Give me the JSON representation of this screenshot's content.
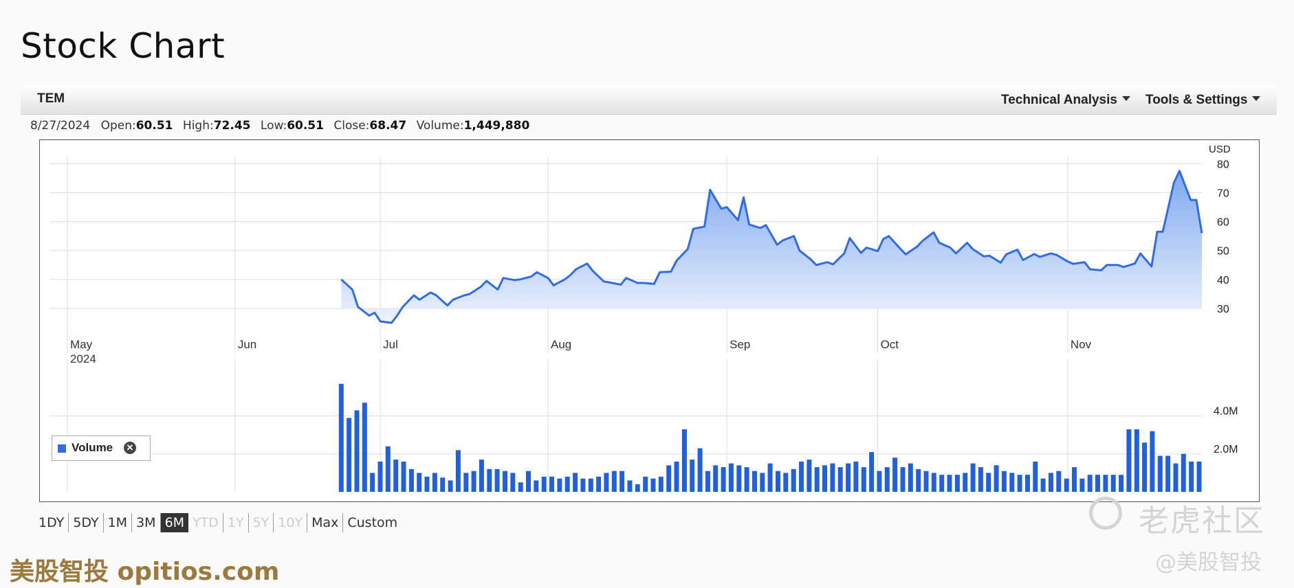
{
  "page": {
    "title": "Stock Chart"
  },
  "toolbar": {
    "ticker": "TEM",
    "technical_analysis": "Technical Analysis",
    "tools_settings": "Tools & Settings"
  },
  "ohlc": {
    "date": "8/27/2024",
    "open_label": "Open:",
    "open": "60.51",
    "high_label": "High:",
    "high": "72.45",
    "low_label": "Low:",
    "low": "60.51",
    "close_label": "Close:",
    "close": "68.47",
    "volume_label": "Volume:",
    "volume": "1,449,880"
  },
  "volume_legend": {
    "label": "Volume"
  },
  "range_buttons": [
    {
      "label": "1DY",
      "state": "normal"
    },
    {
      "label": "5DY",
      "state": "normal"
    },
    {
      "label": "1M",
      "state": "normal"
    },
    {
      "label": "3M",
      "state": "normal"
    },
    {
      "label": "6M",
      "state": "active"
    },
    {
      "label": "YTD",
      "state": "disabled"
    },
    {
      "label": "1Y",
      "state": "disabled"
    },
    {
      "label": "5Y",
      "state": "disabled"
    },
    {
      "label": "10Y",
      "state": "disabled"
    },
    {
      "label": "Max",
      "state": "normal"
    },
    {
      "label": "Custom",
      "state": "normal"
    }
  ],
  "watermarks": {
    "left": "美股智投 opitios.com",
    "right_top": "老虎社区",
    "right_bottom": "@美股智投"
  },
  "colors": {
    "line": "#2f6ce5",
    "fill_top": "#7fa8f0",
    "fill_bottom": "#eef3fd",
    "volume_bar": "#1f5fe0",
    "grid": "#dddddd"
  },
  "chart_data": [
    {
      "type": "area",
      "currency_label": "USD",
      "x_range": [
        "2024-04-26",
        "2024-11-15"
      ],
      "ylim": [
        25,
        82
      ],
      "y_ticks": [
        30,
        40,
        50,
        60,
        70,
        80
      ],
      "x_ticks": [
        {
          "date": "2024-04-26",
          "label": "May",
          "sublabel": "2024"
        },
        {
          "date": "2024-05-26",
          "label": "Jun"
        },
        {
          "date": "2024-06-21",
          "label": "Jul"
        },
        {
          "date": "2024-07-21",
          "label": "Aug"
        },
        {
          "date": "2024-08-22",
          "label": "Sep"
        },
        {
          "date": "2024-09-18",
          "label": "Oct"
        },
        {
          "date": "2024-10-22",
          "label": "Nov"
        }
      ],
      "dates": [
        "2024-06-14",
        "2024-06-16",
        "2024-06-17",
        "2024-06-19",
        "2024-06-20",
        "2024-06-21",
        "2024-06-23",
        "2024-06-24",
        "2024-06-25",
        "2024-06-27",
        "2024-06-28",
        "2024-06-30",
        "2024-07-01",
        "2024-07-03",
        "2024-07-04",
        "2024-07-06",
        "2024-07-07",
        "2024-07-09",
        "2024-07-10",
        "2024-07-12",
        "2024-07-13",
        "2024-07-15",
        "2024-07-16",
        "2024-07-18",
        "2024-07-19",
        "2024-07-21",
        "2024-07-22",
        "2024-07-24",
        "2024-07-25",
        "2024-07-26",
        "2024-07-28",
        "2024-07-29",
        "2024-07-31",
        "2024-08-01",
        "2024-08-03",
        "2024-08-04",
        "2024-08-06",
        "2024-08-07",
        "2024-08-09",
        "2024-08-10",
        "2024-08-12",
        "2024-08-13",
        "2024-08-15",
        "2024-08-16",
        "2024-08-18",
        "2024-08-19",
        "2024-08-21",
        "2024-08-22",
        "2024-08-24",
        "2024-08-25",
        "2024-08-26",
        "2024-08-28",
        "2024-08-29",
        "2024-08-31",
        "2024-09-01",
        "2024-09-03",
        "2024-09-04",
        "2024-09-06",
        "2024-09-07",
        "2024-09-09",
        "2024-09-10",
        "2024-09-12",
        "2024-09-13",
        "2024-09-15",
        "2024-09-16",
        "2024-09-18",
        "2024-09-19",
        "2024-09-20",
        "2024-09-22",
        "2024-09-23",
        "2024-09-25",
        "2024-09-26",
        "2024-09-28",
        "2024-09-29",
        "2024-10-01",
        "2024-10-02",
        "2024-10-04",
        "2024-10-05",
        "2024-10-07",
        "2024-10-08",
        "2024-10-10",
        "2024-10-11",
        "2024-10-13",
        "2024-10-14",
        "2024-10-16",
        "2024-10-17",
        "2024-10-19",
        "2024-10-20",
        "2024-10-22",
        "2024-10-23",
        "2024-10-25",
        "2024-10-26",
        "2024-10-28",
        "2024-10-29",
        "2024-10-31",
        "2024-11-01",
        "2024-11-03",
        "2024-11-04",
        "2024-11-06",
        "2024-11-07",
        "2024-11-08",
        "2024-11-10",
        "2024-11-11",
        "2024-11-13",
        "2024-11-14",
        "2024-11-15"
      ],
      "close": [
        40.0,
        36.5,
        30.5,
        27.5,
        28.5,
        25.5,
        25.0,
        27.5,
        30.5,
        34.5,
        33.0,
        35.5,
        34.5,
        31.0,
        33.0,
        34.5,
        35.0,
        37.5,
        39.5,
        36.5,
        40.5,
        39.8,
        40.0,
        41.0,
        42.5,
        40.5,
        38.0,
        40.0,
        41.5,
        43.5,
        45.5,
        43.0,
        39.3,
        39.0,
        38.2,
        40.5,
        38.8,
        38.8,
        38.5,
        42.5,
        42.7,
        46.5,
        50.5,
        57.5,
        58.3,
        71.0,
        64.5,
        65.0,
        60.5,
        68.4,
        59.0,
        57.8,
        58.8,
        52.0,
        53.5,
        55.0,
        50.0,
        47.0,
        45.0,
        46.0,
        45.2,
        49.0,
        54.3,
        49.2,
        51.0,
        49.8,
        54.0,
        55.0,
        50.7,
        48.7,
        51.3,
        53.3,
        56.3,
        52.7,
        51.0,
        49.0,
        52.7,
        50.5,
        48.0,
        48.2,
        45.8,
        48.7,
        50.3,
        46.7,
        48.8,
        47.8,
        49.0,
        48.5,
        46.2,
        45.4,
        46.0,
        43.5,
        43.2,
        45.0,
        45.0,
        44.3,
        45.5,
        49.0,
        44.5,
        56.5,
        56.5,
        73.5,
        77.5,
        67.5,
        67.5,
        56.0
      ],
      "volume_ticks": [
        2000000,
        4000000
      ],
      "volume_tick_labels": [
        "2.0M",
        "4.0M"
      ],
      "volume_ylim": [
        0,
        5800000
      ],
      "volume": [
        5700000,
        3900000,
        4300000,
        4700000,
        1000000,
        1600000,
        2400000,
        1700000,
        1600000,
        1200000,
        1000000,
        800000,
        1000000,
        750000,
        600000,
        2200000,
        1000000,
        1100000,
        1700000,
        1200000,
        1200000,
        1100000,
        1000000,
        500000,
        1100000,
        600000,
        800000,
        800000,
        700000,
        800000,
        1000000,
        700000,
        700000,
        800000,
        1000000,
        1100000,
        1100000,
        600000,
        400000,
        800000,
        700000,
        800000,
        1400000,
        1600000,
        3300000,
        1700000,
        2300000,
        1100000,
        1400000,
        1300000,
        1500000,
        1400000,
        1300000,
        1100000,
        1000000,
        1500000,
        1100000,
        1000000,
        1200000,
        1600000,
        1700000,
        1300000,
        1400000,
        1500000,
        1300000,
        1500000,
        1600000,
        1300000,
        2100000,
        1100000,
        1300000,
        1800000,
        1300000,
        1500000,
        1200000,
        1100000,
        1000000,
        900000,
        900000,
        900000,
        1000000,
        1500000,
        1300000,
        1000000,
        1400000,
        1100000,
        1000000,
        900000,
        900000,
        1600000,
        700000,
        1000000,
        1100000,
        700000,
        1300000,
        700000,
        900000,
        900000,
        900000,
        900000,
        900000,
        3300000,
        3300000,
        2600000,
        3200000,
        1900000
      ],
      "volume_after_last_close": [
        1900000,
        1500000,
        2000000,
        1600000,
        1600000
      ]
    }
  ]
}
